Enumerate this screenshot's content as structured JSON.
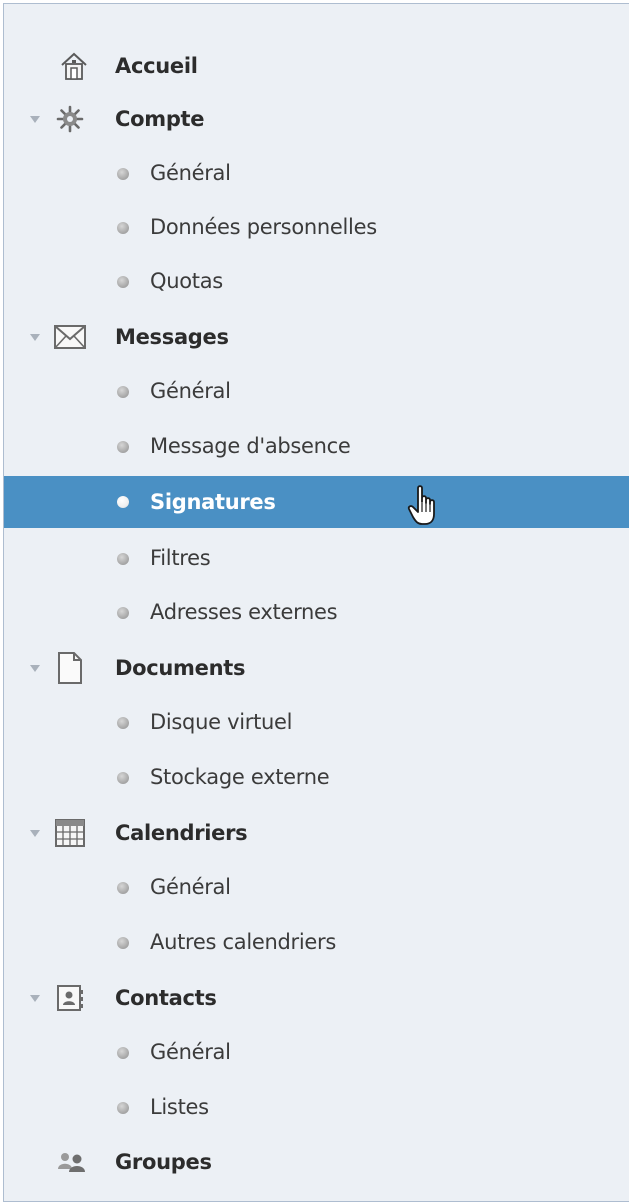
{
  "nav": {
    "accueil": "Accueil",
    "compte": {
      "label": "Compte",
      "items": [
        "Général",
        "Données personnelles",
        "Quotas"
      ]
    },
    "messages": {
      "label": "Messages",
      "items": [
        "Général",
        "Message d'absence",
        "Signatures",
        "Filtres",
        "Adresses externes"
      ],
      "selected": "Signatures"
    },
    "documents": {
      "label": "Documents",
      "items": [
        "Disque virtuel",
        "Stockage externe"
      ]
    },
    "calendriers": {
      "label": "Calendriers",
      "items": [
        "Général",
        "Autres calendriers"
      ]
    },
    "contacts": {
      "label": "Contacts",
      "items": [
        "Général",
        "Listes"
      ]
    },
    "groupes": "Groupes"
  },
  "colors": {
    "panel_bg": "#ecf0f5",
    "selected_bg": "#4a90c4",
    "panel_border": "#aebdd0"
  },
  "icons": {
    "accueil": "home-icon",
    "compte": "gear-icon",
    "messages": "envelope-icon",
    "documents": "document-icon",
    "calendriers": "calendar-icon",
    "contacts": "contact-card-icon",
    "groupes": "group-icon",
    "cursor": "hand-pointer-icon"
  }
}
